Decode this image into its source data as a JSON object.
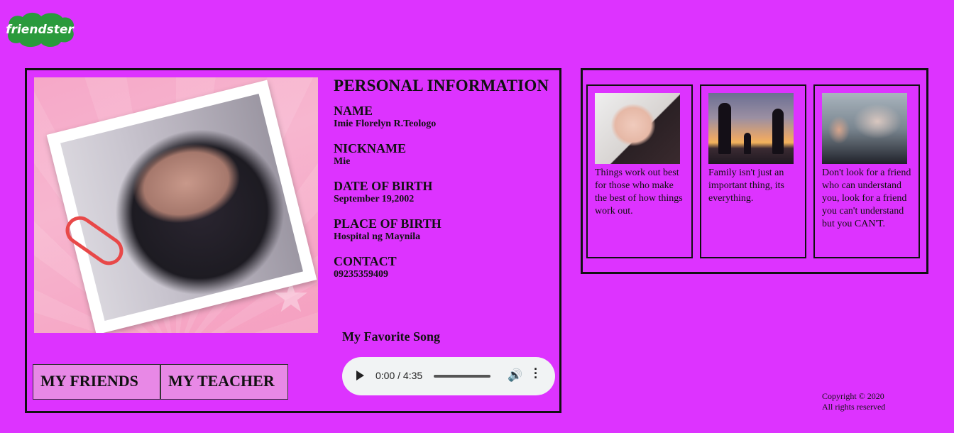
{
  "brand": {
    "logo_text": "friendster"
  },
  "profile": {
    "heading": "PERSONAL INFORMATION",
    "fields": [
      {
        "label": "NAME",
        "value": "Imie Florelyn R.Teologo"
      },
      {
        "label": "NICKNAME",
        "value": "Mie"
      },
      {
        "label": "DATE OF BIRTH",
        "value": "September 19,2002"
      },
      {
        "label": "PLACE OF BIRTH",
        "value": "Hospital ng Maynila"
      },
      {
        "label": "CONTACT",
        "value": "09235359409"
      }
    ]
  },
  "song": {
    "title": "My Favorite Song",
    "time": "0:00 / 4:35",
    "progress_fraction": 0
  },
  "nav": {
    "friends": "MY FRIENDS",
    "teacher": "MY TEACHER"
  },
  "gallery": [
    {
      "caption": "Things work out best for those who make the best of how things work out."
    },
    {
      "caption": "Family isn't just an important thing, its everything."
    },
    {
      "caption": "Don't look for a friend who can understand you, look for a friend you can't understand but you CAN'T."
    }
  ],
  "footer": {
    "line1": "Copyright © 2020",
    "line2": "All rights reserved"
  },
  "colors": {
    "background": "#dd33ff",
    "button": "#e888e6",
    "logo": "#2a9a3c"
  }
}
